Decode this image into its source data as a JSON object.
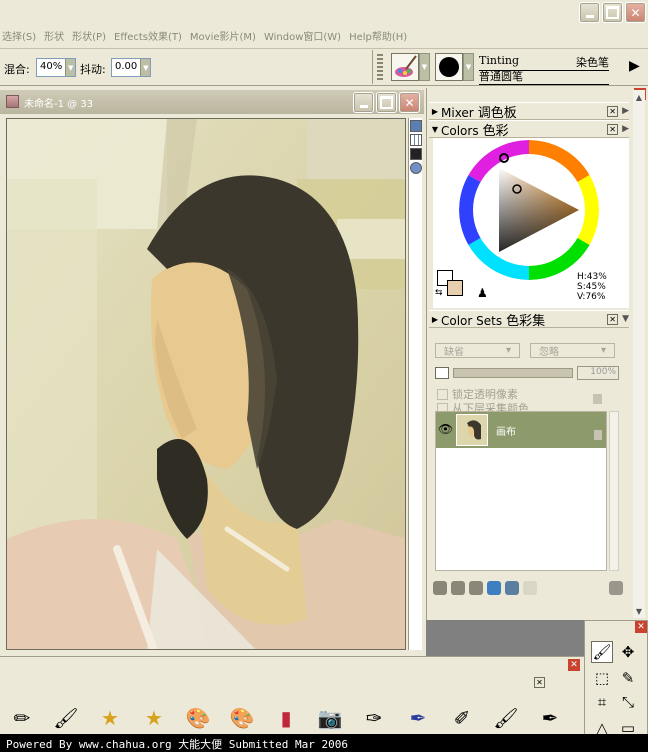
{
  "menu": {
    "items": [
      "选择(S)",
      "形状",
      "形状(P)",
      "Effects效果(T)",
      "Movie影片(M)",
      "Window窗口(W)",
      "Help帮助(H)"
    ]
  },
  "propbar": {
    "blend_label": "混合:",
    "blend_value": "40%",
    "jitter_label": "抖动:",
    "jitter_value": "0.00"
  },
  "brush": {
    "category": "Tinting",
    "category_cn": "染色笔",
    "variant": "普通圆笔"
  },
  "document": {
    "title": "未命名-1 @ 33"
  },
  "palettes": {
    "mixer_en": "Mixer",
    "mixer_cn": "调色板",
    "colors_en": "Colors",
    "colors_cn": "色彩",
    "color_sets_en": "Color Sets",
    "color_sets_cn": "色彩集",
    "h_value": "H:43%",
    "s_value": "S:45%",
    "v_value": "V:76%",
    "primary_color": "#ffffff",
    "secondary_color": "#e6cfae",
    "hue_color": "#f7a33c"
  },
  "layers": {
    "composite_method": "缺省",
    "composite_depth": "忽略",
    "opacity_value": "100%",
    "preserve_transparency": "锁定透明像素",
    "pick_up_underlying": "从下层采集颜色",
    "layer_name": "画布"
  },
  "footer": {
    "text": "Powered By www.chahua.org 大能大便 Submitted Mar 2006"
  }
}
